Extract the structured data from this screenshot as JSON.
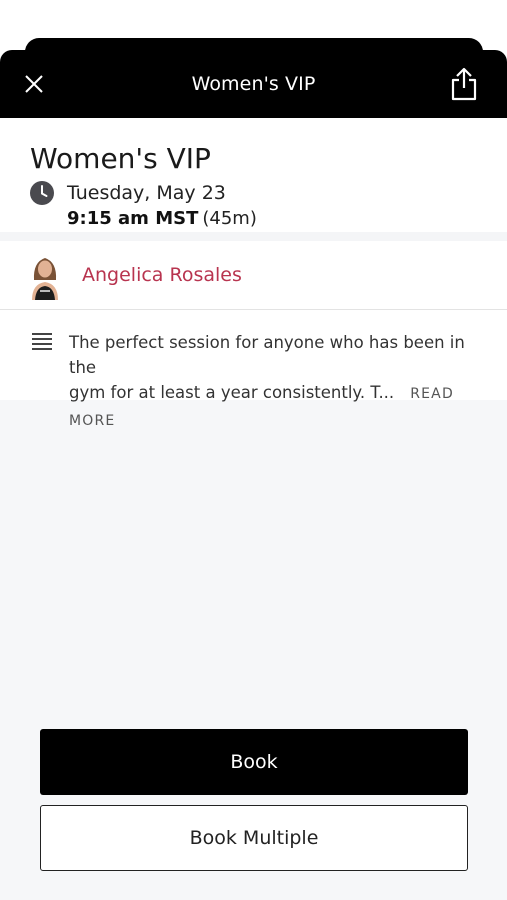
{
  "header": {
    "title": "Women's VIP",
    "close_icon": "close-icon",
    "share_icon": "share-icon"
  },
  "class_info": {
    "title": "Women's VIP",
    "date": "Tuesday, May 23",
    "time": "9:15 am MST",
    "duration": "(45m)"
  },
  "instructor": {
    "name": "Angelica Rosales",
    "name_color": "#b8344f"
  },
  "description": {
    "line1": "The perfect session for anyone who has been in the",
    "line2": "gym for at least a year consistently. T...",
    "read_more": "READ MORE"
  },
  "actions": {
    "book_label": "Book",
    "book_multiple_label": "Book Multiple"
  },
  "colors": {
    "header_bg": "#000000",
    "accent": "#b8344f",
    "page_bg": "#f6f7f9"
  }
}
